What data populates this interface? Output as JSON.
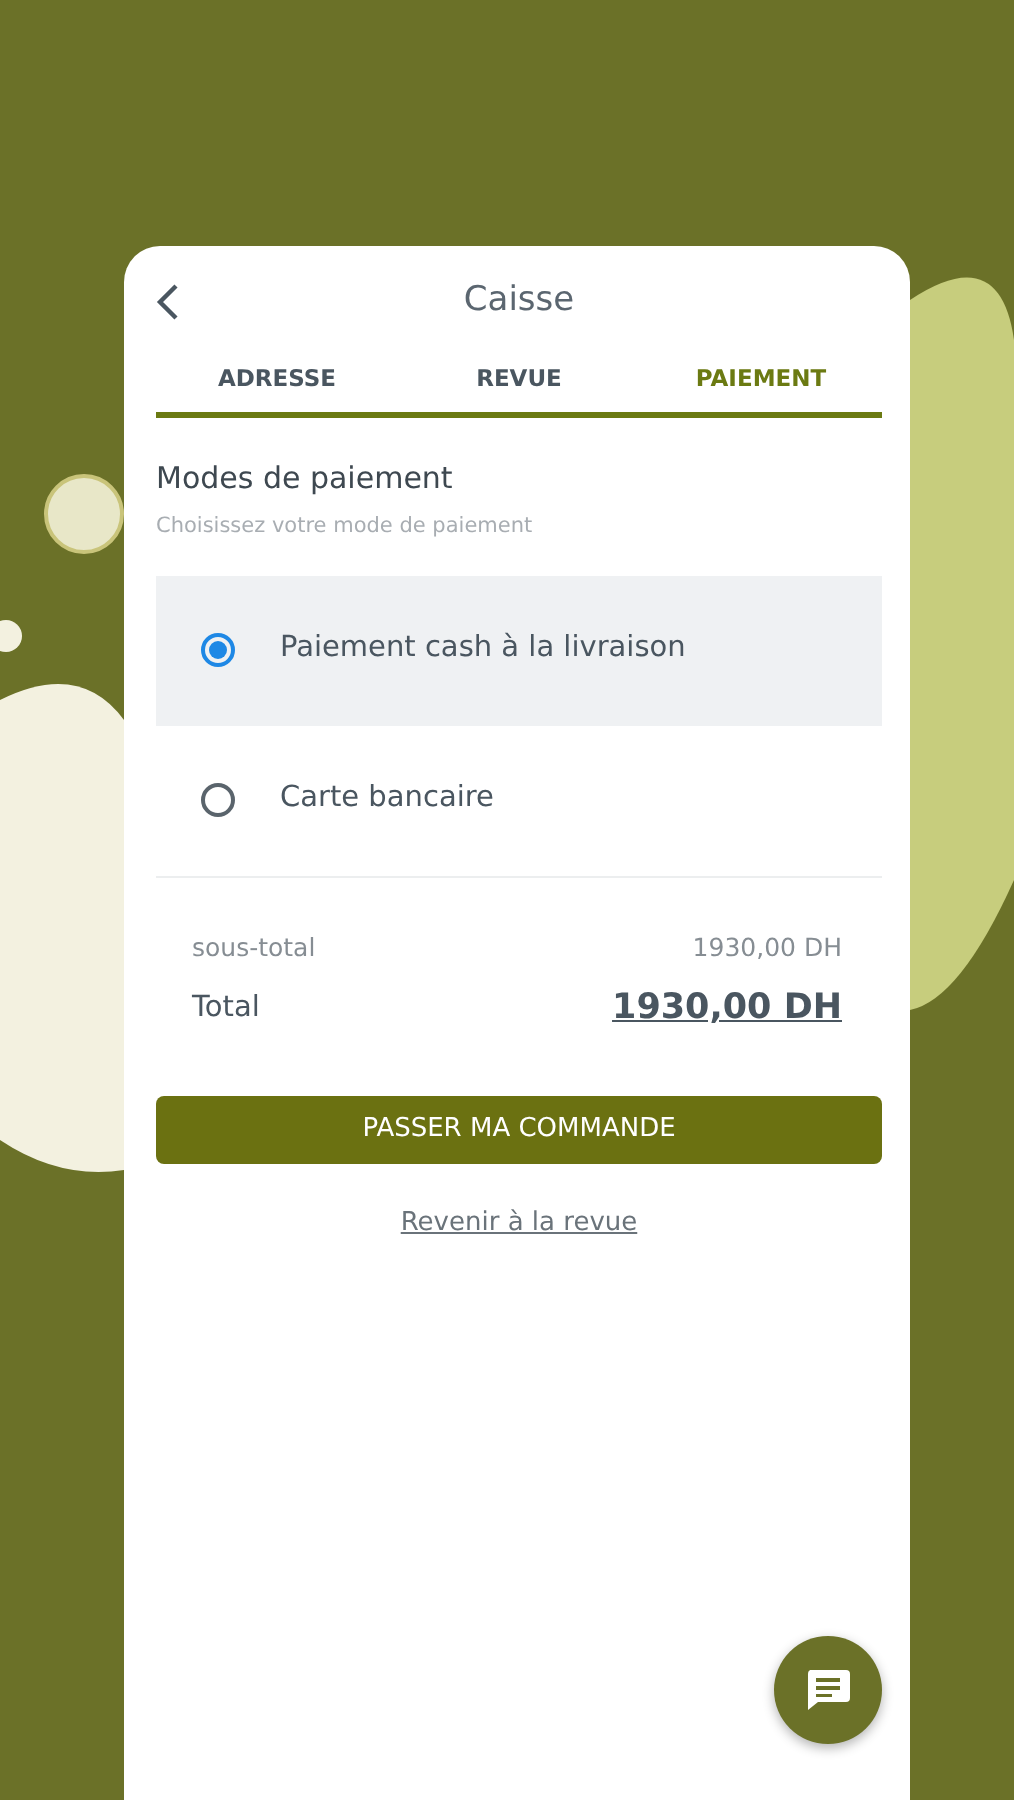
{
  "header": {
    "title": "Caisse"
  },
  "tabs": [
    {
      "label": "ADRESSE",
      "selected": false
    },
    {
      "label": "REVUE",
      "selected": false
    },
    {
      "label": "PAIEMENT",
      "selected": true
    }
  ],
  "section": {
    "title": "Modes de paiement",
    "subtitle": "Choisissez votre mode de paiement"
  },
  "payment_options": [
    {
      "label": "Paiement cash à la livraison",
      "selected": true
    },
    {
      "label": "Carte bancaire",
      "selected": false
    }
  ],
  "summary": {
    "subtotal_label": "sous-total",
    "subtotal_value": "1930,00 DH",
    "total_label": "Total",
    "total_value": "1930,00 DH"
  },
  "primary_button": "PASSER MA COMMANDE",
  "back_link": "Revenir à la revue"
}
